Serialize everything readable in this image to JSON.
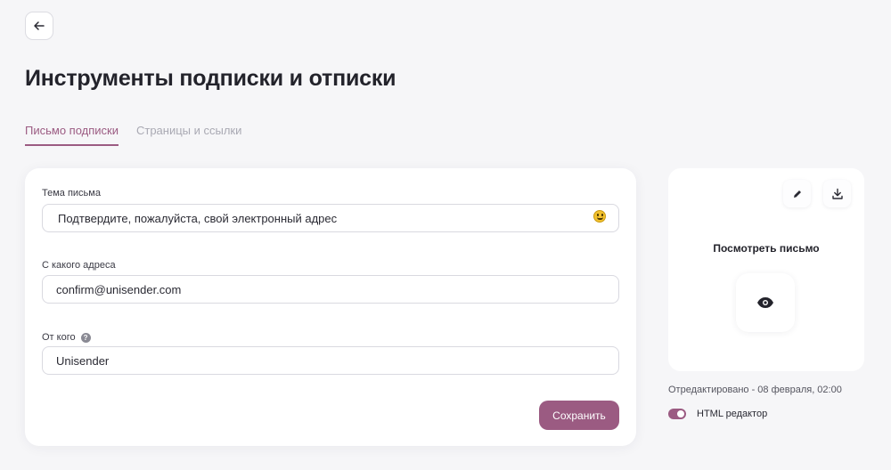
{
  "header": {
    "back_icon": "arrow-left-icon",
    "title": "Инструменты подписки и отписки"
  },
  "tabs": [
    {
      "label": "Письмо подписки",
      "active": true
    },
    {
      "label": "Страницы и ссылки",
      "active": false
    }
  ],
  "form": {
    "subject": {
      "label": "Тема письма",
      "value": "Подтвердите, пожалуйста, свой электронный адрес",
      "emoji_icon": "smiley-icon"
    },
    "from_address": {
      "label": "С какого адреса",
      "value": "confirm@unisender.com"
    },
    "from_name": {
      "label": "От кого",
      "help_icon": "question-icon",
      "help_mark": "?",
      "value": "Unisender"
    },
    "save_label": "Сохранить"
  },
  "preview": {
    "edit_icon": "pencil-icon",
    "download_icon": "download-icon",
    "title": "Посмотреть письмо",
    "eye_icon": "eye-icon",
    "edited_text": "Отредактировано - 08 февраля, 02:00",
    "html_editor_label": "HTML редактор",
    "html_editor_enabled": true
  },
  "colors": {
    "accent": "#9b5b82",
    "background": "#f6f6f8",
    "card": "#ffffff",
    "inactive_tab": "#a9a9b3"
  }
}
